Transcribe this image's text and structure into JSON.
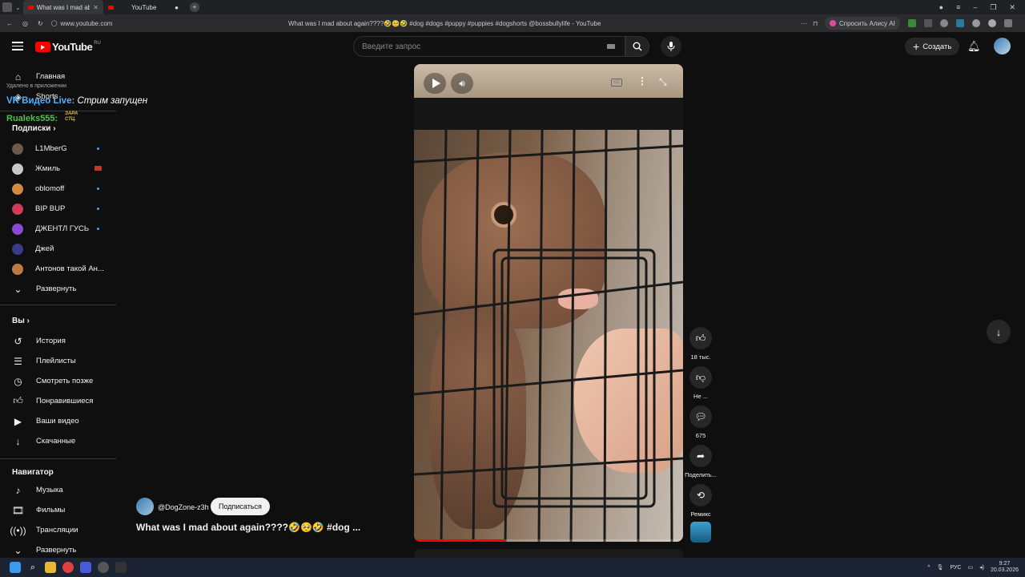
{
  "browser": {
    "tabs": [
      {
        "label": "What was I mad about"
      },
      {
        "label": "YouTube"
      }
    ],
    "url": "www.youtube.com",
    "page_title": "What was I mad about again????🤣🥺🤣 #dog #dogs #puppy #puppies #dogshorts @bossbullylife - YouTube",
    "ask_ai": "Спросить Алису AI"
  },
  "header": {
    "logo_text": "YouTube",
    "logo_region": "RU",
    "search_placeholder": "Введите запрос",
    "create_label": "Создать"
  },
  "overlay": {
    "removed_text": "Удалено в приложении",
    "vk_live_label": "VK Видео Live:",
    "vk_live_status": "Стрим запущен",
    "user_name": "Rualeks555:",
    "badge_text": "ЗАРА СТЦ."
  },
  "sidebar": {
    "home": "Главная",
    "shorts": "Shorts",
    "subscriptions_title": "Подписки",
    "subscriptions": [
      {
        "name": "L1MberG",
        "color": "#6b5a4a",
        "live": false
      },
      {
        "name": "Жмиль",
        "color": "#c8c8c8",
        "live": true
      },
      {
        "name": "oblomoff",
        "color": "#d08a40",
        "live": false
      },
      {
        "name": "BIP BUP",
        "color": "#d23a5a",
        "live": false
      },
      {
        "name": "ДЖЕНТЛ ГУСЬ",
        "color": "#8a4ad8",
        "live": false
      },
      {
        "name": "Джей",
        "color": "#3a3a8a",
        "live": false
      },
      {
        "name": "Антонов такой Ан...",
        "color": "#c07a40",
        "live": false
      }
    ],
    "expand_1": "Развернуть",
    "you_title": "Вы",
    "you_items": [
      {
        "label": "История",
        "icon": "history-icon"
      },
      {
        "label": "Плейлисты",
        "icon": "playlist-icon"
      },
      {
        "label": "Смотреть позже",
        "icon": "clock-icon"
      },
      {
        "label": "Понравившиеся",
        "icon": "thumbs-up-icon"
      },
      {
        "label": "Ваши видео",
        "icon": "video-icon"
      },
      {
        "label": "Скачанные",
        "icon": "download-icon"
      }
    ],
    "navigator_title": "Навигатор",
    "navigator_items": [
      {
        "label": "Музыка",
        "icon": "music-icon"
      },
      {
        "label": "Фильмы",
        "icon": "film-icon"
      },
      {
        "label": "Трансляции",
        "icon": "broadcast-icon"
      }
    ],
    "expand_2": "Развернуть"
  },
  "video": {
    "channel": "@DogZone-z3h",
    "subscribe_label": "Подписаться",
    "title": "What was I mad about again????🤣🥺🤣 #dog ...",
    "progress_fraction": 0.34
  },
  "actions": {
    "likes": "18 тыс.",
    "dislike": "Не ...",
    "comments": "675",
    "share": "Поделить...",
    "remix": "Ремикс"
  },
  "taskbar": {
    "lang": "РУС",
    "time": "9:27",
    "date": "20.03.2026"
  }
}
